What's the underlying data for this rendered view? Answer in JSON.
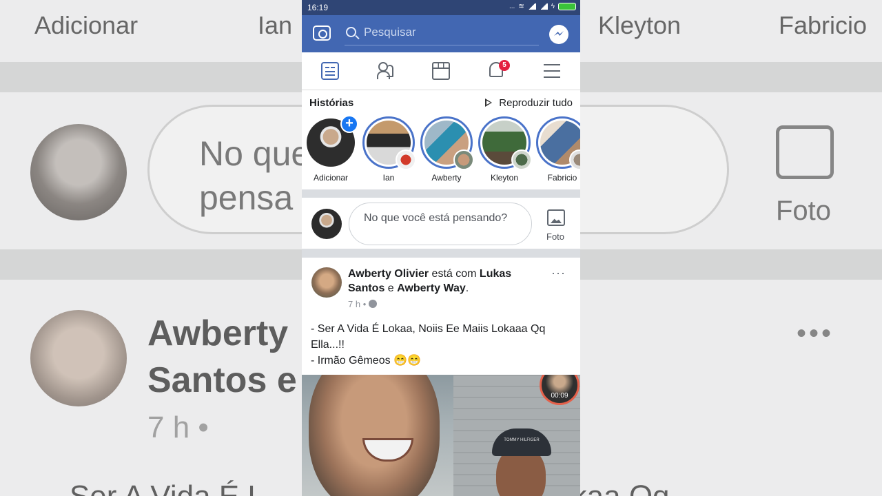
{
  "statusbar": {
    "time": "16:19",
    "signal": "...",
    "network": "4G"
  },
  "search": {
    "placeholder": "Pesquisar"
  },
  "nav": {
    "notifications_badge": "5"
  },
  "stories": {
    "title": "Histórias",
    "play_all": "Reproduzir tudo",
    "items": [
      {
        "name": "Adicionar"
      },
      {
        "name": "Ian"
      },
      {
        "name": "Awberty"
      },
      {
        "name": "Kleyton"
      },
      {
        "name": "Fabricio"
      }
    ]
  },
  "composer": {
    "prompt": "No que você está pensando?",
    "photo_label": "Foto"
  },
  "post": {
    "author": "Awberty Olivier",
    "with_text": "está com",
    "tagged1": "Lukas Santos",
    "and_text": "e",
    "tagged2": "Awberty Way",
    "period": ".",
    "time": "7 h",
    "dot": "•",
    "body": "- Ser A Vida É Lokaa, Noiis Ee Maiis Lokaaa Qq Ella...!!\n   - Irmão Gêmeos 😁😁",
    "more": "···",
    "video_time": "00:09",
    "cap_text": "TOMMY HILFIGER"
  },
  "background": {
    "names": [
      "Adicionar",
      "Ian",
      "Kleyton",
      "Fabricio"
    ],
    "composer_text": "No que\npensa",
    "foto": "Foto",
    "post_name": "Awberty            n Lukas\nSantos e",
    "post_time": "7 h •",
    "post_body": "- Ser A Vida É L                              ii Lokaa Qq",
    "dots": "•••"
  }
}
